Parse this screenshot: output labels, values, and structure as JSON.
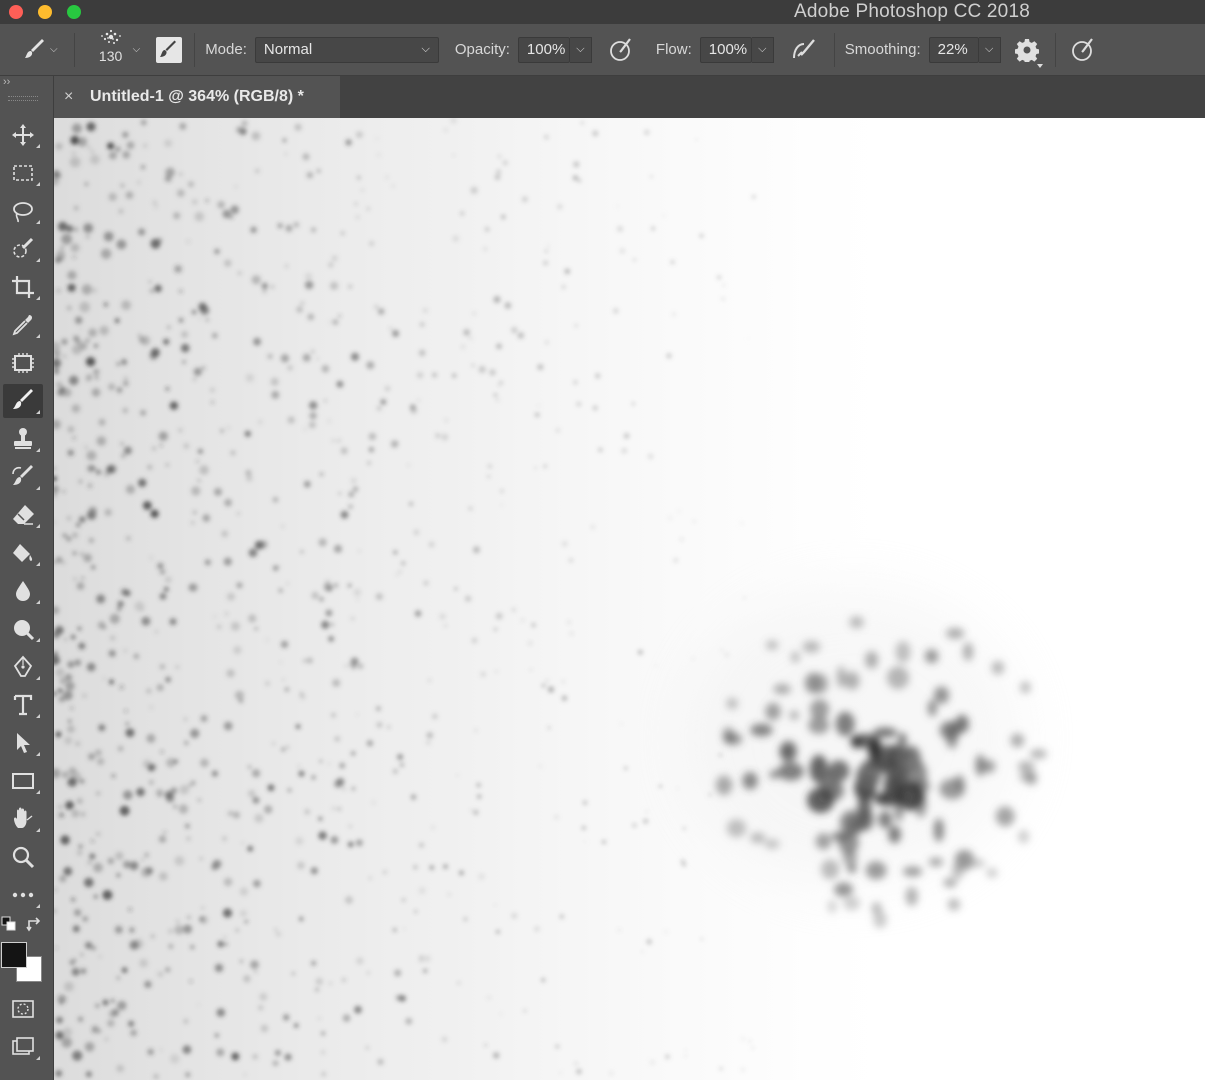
{
  "window": {
    "app_title": "Adobe Photoshop CC 2018"
  },
  "options_bar": {
    "brush_size": "130",
    "mode_label": "Mode:",
    "mode_value": "Normal",
    "opacity_label": "Opacity:",
    "opacity_value": "100%",
    "flow_label": "Flow:",
    "flow_value": "100%",
    "smoothing_label": "Smoothing:",
    "smoothing_value": "22%"
  },
  "document_tab": {
    "close_glyph": "×",
    "title": "Untitled-1 @ 364% (RGB/8) *"
  },
  "toolbar": {
    "active_tool": "brush-tool",
    "foreground_color": "#141414",
    "background_color": "#ffffff",
    "tools": [
      "move-tool",
      "marquee-tool",
      "lasso-tool",
      "quick-selection-tool",
      "crop-tool",
      "eyedropper-tool",
      "frame-tool",
      "brush-tool",
      "clone-stamp-tool",
      "history-brush-tool",
      "eraser-tool",
      "paint-bucket-tool",
      "blur-tool",
      "dodge-tool",
      "pen-tool",
      "type-tool",
      "path-selection-tool",
      "rectangle-tool",
      "hand-tool",
      "zoom-tool",
      "more-tools",
      "quick-mask",
      "screen-mode"
    ]
  },
  "colors": {
    "ui_bg": "#535353",
    "title_bg": "#3c3c3c",
    "tab_bar_bg": "#424242",
    "canvas_bg": "#ffffff"
  }
}
